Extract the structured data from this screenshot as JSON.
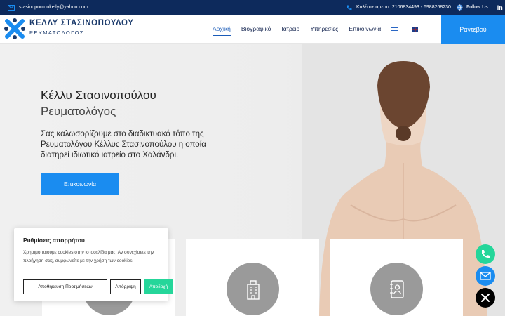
{
  "topbar": {
    "email": "stasinopouloukelly@yahoo.com",
    "phone": "Καλέστε άμεσα: 2106834493 - 6988268230",
    "follow": "Follow Us:",
    "linkedin": "in"
  },
  "brand": {
    "name": "ΚΕΛΛΥ ΣΤΑΣΙΝΟΠΟΥΛΟΥ",
    "subtitle": "ΡΕΥΜΑΤΟΛΟΓΟΣ",
    "colors": {
      "navy": "#0d2a5c",
      "accent": "#1a8cf0",
      "green": "#25d69a"
    }
  },
  "nav": {
    "items": [
      "Αρχική",
      "Βιογραφικό",
      "Ιατρειο",
      "Υπηρεσίες",
      "Επικοινωνία"
    ],
    "active": "Αρχική",
    "flags": [
      "greek-flag-icon",
      "english-flag-icon"
    ],
    "book": "Ραντεβού"
  },
  "hero": {
    "title": "Κέλλυ Στασινοπούλου",
    "subtitle": "Ρευματολόγος",
    "text": "Σας καλωσορίζουμε στο διαδικτυακό τόπο της Ρευματολόγου Κέλλυς Στασινοπούλου η οποία διατηρεί ιδιωτικό ιατρείο στο Χαλάνδρι.",
    "button": "Επικοινωνία"
  },
  "cards": {
    "icons": [
      "doctor-icon",
      "hospital-building-icon",
      "address-book-icon"
    ]
  },
  "cookie": {
    "title": "Ρυθμίσεις απορρήτου",
    "text": "Χρησιμοποιούμε cookies στην ιστοσελίδα μας. Αν συνεχίσετε την πλοήγηση σας, συμφωνείτε με την χρήση των cookies.",
    "save": "Αποθήκευση Προτιμήσεων",
    "reject": "Απόρριψη",
    "accept": "Αποδοχή"
  },
  "floating": [
    "phone-icon",
    "mail-icon",
    "close-icon"
  ]
}
